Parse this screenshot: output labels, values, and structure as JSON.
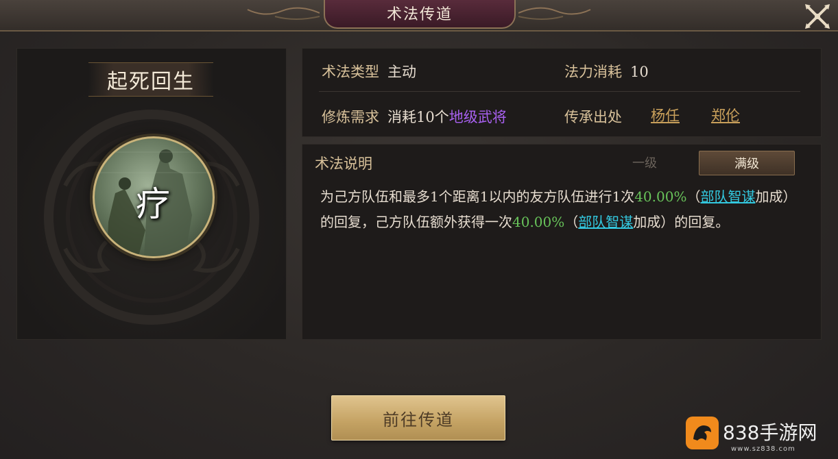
{
  "window": {
    "title": "术法传道"
  },
  "skill": {
    "name": "起死回生",
    "icon_glyph": "疗"
  },
  "info": {
    "type_label": "术法类型",
    "type_value": "主动",
    "cost_label": "法力消耗",
    "cost_value": "10",
    "req_label": "修炼需求",
    "req_prefix": "消耗10个",
    "req_highlight": "地级武将",
    "source_label": "传承出处",
    "sources": [
      "杨任",
      "郑伦"
    ]
  },
  "description": {
    "title": "术法说明",
    "tabs": [
      {
        "label": "一级",
        "active": false
      },
      {
        "label": "满级",
        "active": true
      }
    ],
    "seg1": "为己方队伍和最多1个距离1以内的友方队伍进行1次",
    "val1": "40.00%",
    "seg2": "（",
    "link1": "部队智谋",
    "seg3": "加成）的回复，己方队伍额外获得一次",
    "val2": "40.00%",
    "seg4": "（",
    "link2": "部队智谋",
    "seg5": "加成）的回复。"
  },
  "actions": {
    "go_label": "前往传道"
  },
  "watermark": {
    "brand": "838手游网",
    "url": "www.sz838.com"
  },
  "colors": {
    "accent_gold": "#c9a05b",
    "highlight_purple": "#a860f0",
    "value_green": "#68c35a",
    "link_cyan": "#33c9e0"
  },
  "icons": {
    "close": "close-x-icon",
    "logo": "dragon-logo-icon"
  }
}
